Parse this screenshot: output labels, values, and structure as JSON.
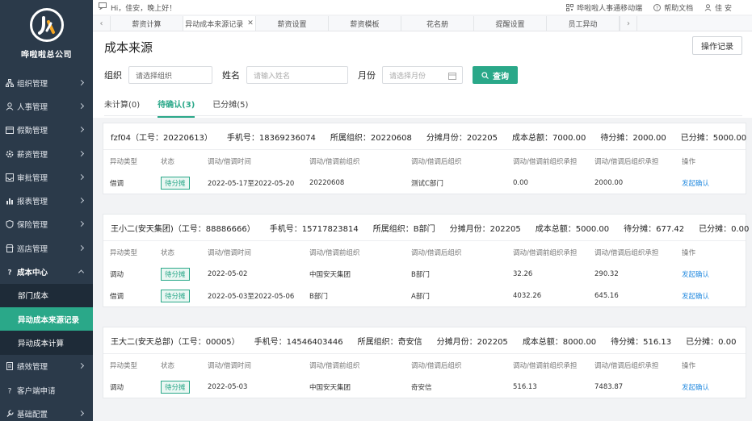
{
  "sidebar": {
    "company": "哗啦啦总公司",
    "items": [
      {
        "label": "组织管理",
        "icon": "org-icon"
      },
      {
        "label": "人事管理",
        "icon": "person-icon"
      },
      {
        "label": "假勤管理",
        "icon": "calendar-icon"
      },
      {
        "label": "薪资管理",
        "icon": "gear-icon"
      },
      {
        "label": "审批管理",
        "icon": "inbox-icon"
      },
      {
        "label": "报表管理",
        "icon": "chart-icon"
      },
      {
        "label": "保险管理",
        "icon": "shield-icon"
      },
      {
        "label": "巡店管理",
        "icon": "store-icon"
      },
      {
        "label": "成本中心",
        "icon": "help-icon"
      }
    ],
    "sub_items": [
      "部门成本",
      "异动成本来源记录",
      "异动成本计算"
    ],
    "items_after": [
      {
        "label": "绩效管理",
        "icon": "doc-icon"
      },
      {
        "label": "客户端申请",
        "icon": "help-icon"
      },
      {
        "label": "基础配置",
        "icon": "tool-icon"
      }
    ]
  },
  "topbar": {
    "greeting": "Hi，佳安，晚上好！",
    "mobile": "哗啦啦人事通移动端",
    "help": "帮助文档",
    "user": "佳 安"
  },
  "tabs": [
    "薪资计算",
    "异动成本来源记录",
    "薪资设置",
    "薪资模板",
    "花名册",
    "提醒设置",
    "员工异动"
  ],
  "page": {
    "title": "成本来源",
    "op_button": "操作记录",
    "org_label": "组织",
    "org_value": "请选择组织",
    "name_label": "姓名",
    "name_placeholder": "请输入姓名",
    "month_label": "月份",
    "month_placeholder": "请选择月份",
    "search": "查询"
  },
  "subtabs": [
    "未计算(0)",
    "待确认(3)",
    "已分摊(5)"
  ],
  "columns": [
    "异动类型",
    "状态",
    "调动/借调时间",
    "调动/借调前组织",
    "调动/借调后组织",
    "调动/借调前组织承担",
    "调动/借调后组织承担",
    "操作"
  ],
  "cards": [
    {
      "name": "fzf04（工号：20220613）",
      "phone": "手机号：18369236074",
      "org": "所属组织：20220608",
      "month": "分摊月份：202205",
      "total": "成本总额：7000.00",
      "pending": "待分摊：2000.00",
      "allocated": "已分摊：5000.00",
      "rows": [
        {
          "type": "借调",
          "status": "待分摊",
          "time": "2022-05-17至2022-05-20",
          "from": "20220608",
          "to": "测试C部门",
          "from_amt": "0.00",
          "to_amt": "2000.00",
          "action": "发起确认"
        }
      ]
    },
    {
      "name": "王小二(安天集团)（工号：88886666）",
      "phone": "手机号：15717823814",
      "org": "所属组织：B部门",
      "month": "分摊月份：202205",
      "total": "成本总额：5000.00",
      "pending": "待分摊：677.42",
      "allocated": "已分摊：0.00",
      "rows": [
        {
          "type": "调动",
          "status": "待分摊",
          "time": "2022-05-02",
          "from": "中国安天集团",
          "to": "B部门",
          "from_amt": "32.26",
          "to_amt": "290.32",
          "action": "发起确认"
        },
        {
          "type": "借调",
          "status": "待分摊",
          "time": "2022-05-03至2022-05-06",
          "from": "B部门",
          "to": "A部门",
          "from_amt": "4032.26",
          "to_amt": "645.16",
          "action": "发起确认"
        }
      ]
    },
    {
      "name": "王大二(安天总部)（工号：00005）",
      "phone": "手机号：14546403446",
      "org": "所属组织：奇安信",
      "month": "分摊月份：202205",
      "total": "成本总额：8000.00",
      "pending": "待分摊：516.13",
      "allocated": "已分摊：0.00",
      "rows": [
        {
          "type": "调动",
          "status": "待分摊",
          "time": "2022-05-03",
          "from": "中国安天集团",
          "to": "奇安信",
          "from_amt": "516.13",
          "to_amt": "7483.87",
          "action": "发起确认"
        }
      ]
    }
  ]
}
